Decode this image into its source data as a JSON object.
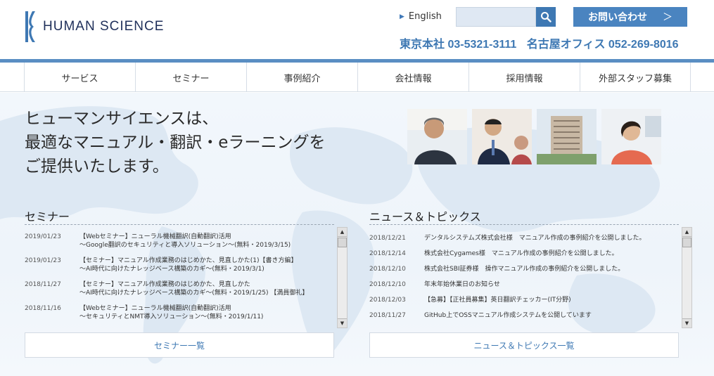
{
  "header": {
    "logo_text": "HUMAN SCIENCE",
    "lang_link": "English",
    "search_placeholder": "",
    "contact_label": "お問い合わせ",
    "contact_arrow": "＞",
    "phone_tokyo": "東京本社 03-5321-3111",
    "phone_nagoya": "名古屋オフィス 052-269-8016"
  },
  "nav": {
    "items": [
      "サービス",
      "セミナー",
      "事例紹介",
      "会社情報",
      "採用情報",
      "外部スタッフ募集"
    ]
  },
  "hero": {
    "line1": "ヒューマンサイエンスは、",
    "line2": "最適なマニュアル・翻訳・eラーニングを",
    "line3": "ご提供いたします。"
  },
  "seminar": {
    "title": "セミナー",
    "items": [
      {
        "date": "2019/01/23",
        "line1": "【Webセミナー】ニューラル機械翻訳(自動翻訳)活用",
        "line2": "～Google翻訳のセキュリティと導入ソリューション～(無料・2019/3/15)"
      },
      {
        "date": "2019/01/23",
        "line1": "【セミナー】マニュアル作成業務のはじめかた、見直しかた(1)【書き方編】",
        "line2": "～AI時代に向けたナレッジベース構築のカギ～(無料・2019/3/1)"
      },
      {
        "date": "2018/11/27",
        "line1": "【セミナー】マニュアル作成業務のはじめかた、見直しかた",
        "line2": "～AI時代に向けたナレッジベース構築のカギ～(無料・2019/1/25) 【満員御礼】"
      },
      {
        "date": "2018/11/16",
        "line1": "【Webセミナー】ニューラル機械翻訳(自動翻訳)活用",
        "line2": "～セキュリティとNMT導入ソリューション～(無料・2019/1/11)"
      }
    ],
    "more_label": "セミナー一覧"
  },
  "news": {
    "title": "ニュース＆トピックス",
    "items": [
      {
        "date": "2018/12/21",
        "text": "デンタルシステムズ株式会社様　マニュアル作成の事例紹介を公開しました。"
      },
      {
        "date": "2018/12/14",
        "text": "株式会社Cygames様　マニュアル作成の事例紹介を公開しました。"
      },
      {
        "date": "2018/12/10",
        "text": "株式会社SBI証券様　操作マニュアル作成の事例紹介を公開しました。"
      },
      {
        "date": "2018/12/10",
        "text": "年末年始休業日のお知らせ"
      },
      {
        "date": "2018/12/03",
        "text": "【急募】【正社員募集】英日翻訳チェッカー(IT分野)"
      },
      {
        "date": "2018/11/27",
        "text": "GitHub上でOSSマニュアル作成システムを公開しています"
      }
    ],
    "more_label": "ニュース＆トピックス一覧"
  },
  "colors": {
    "brand_blue": "#3e78b3",
    "nav_bar": "#5a8ec3",
    "contact_button": "#4a84c0"
  },
  "icons": {
    "search": "search-icon",
    "lang": "triangle-right-icon",
    "scroll_up": "scroll-up-arrow-icon",
    "scroll_down": "scroll-down-arrow-icon"
  }
}
